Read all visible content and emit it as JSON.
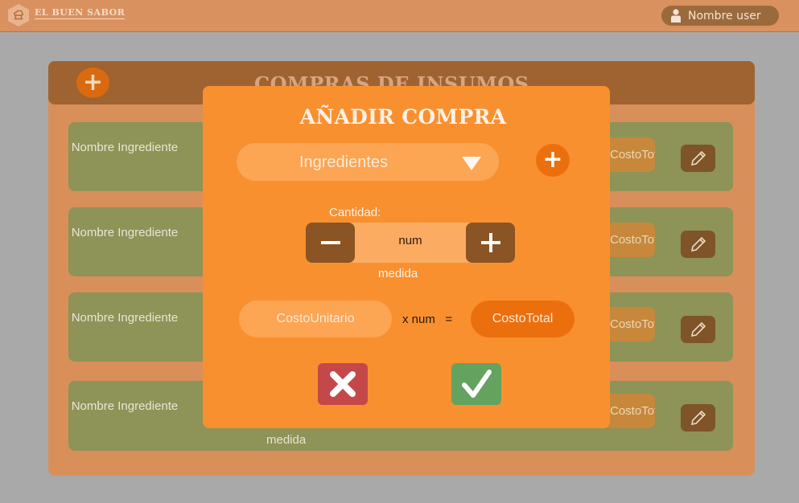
{
  "header": {
    "brand": "EL BUEN SABOR",
    "user_name": "Nombre user",
    "logo_icon": "chef-hat-icon",
    "user_icon": "user-icon"
  },
  "page": {
    "title": "COMPRAS DE INSUMOS",
    "add_label": "+",
    "rows": [
      {
        "name": "Nombre Ingrediente",
        "total": "CostoTotal"
      },
      {
        "name": "Nombre Ingrediente",
        "total": "CostoTotal"
      },
      {
        "name": "Nombre Ingrediente",
        "total": "CostoTotal"
      },
      {
        "name": "Nombre Ingrediente",
        "total": "CostoTotal"
      }
    ],
    "last_row_unit": "medida"
  },
  "modal": {
    "title": "AÑADIR COMPRA",
    "ingredient_select": "Ingredientes",
    "add_label": "+",
    "quantity_label": "Cantidad:",
    "quantity_value": "num",
    "unit_label": "medida",
    "unit_cost": "CostoUnitario",
    "formula": "x num   =",
    "total_cost": "CostoTotal"
  },
  "colors": {
    "header": "#d9915f",
    "modal": "#f9902f",
    "row": "#8e9357",
    "cancel": "#c4484a",
    "confirm": "#63a25f"
  }
}
